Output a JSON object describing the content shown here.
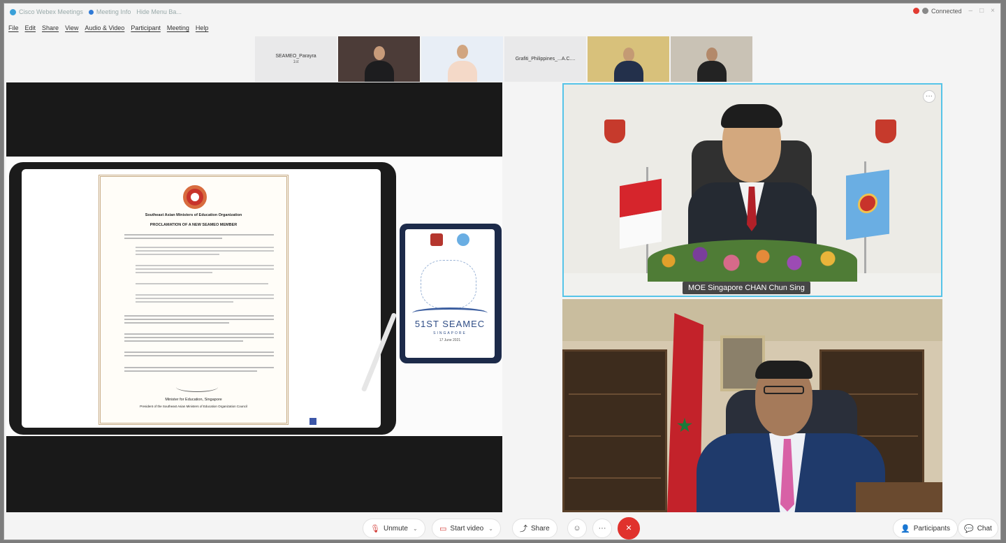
{
  "window": {
    "app_title": "Cisco Webex Meetings",
    "meeting_info_label": "Meeting Info",
    "view_label": "Hide Menu Ba...",
    "status": "Connected",
    "status_color": "#e23b32"
  },
  "menu": [
    "File",
    "Edit",
    "Share",
    "View",
    "Audio & Video",
    "Participant",
    "Meeting",
    "Help"
  ],
  "thumbnails": [
    {
      "type": "name",
      "name": "SEAMEO_Parayra",
      "sub": "1st"
    },
    {
      "type": "video",
      "bg": "#4c3c38"
    },
    {
      "type": "video",
      "bg": "#e8eef6"
    },
    {
      "type": "name",
      "name": "Grafiti_Philippines_...A.C....",
      "sub": ""
    },
    {
      "type": "video",
      "bg": "#d8c17b"
    },
    {
      "type": "video",
      "bg": "#c9c2b5"
    }
  ],
  "shared_content": {
    "cert_org": "Southeast Asian Ministers of Education Organization",
    "cert_title": "PROCLAMATION OF A NEW SEAMEO MEMBER",
    "cert_signatory": "Minister for Education, Singapore",
    "cert_footer": "President of the Southeast Asian Ministers of Education Organization Council",
    "event_brand": "51ST SEAMEC",
    "event_sub": "SINGAPORE",
    "event_date": "17 June 2021"
  },
  "video_tiles": {
    "main_speaker_label": "MOE Singapore CHAN Chun Sing",
    "more_icon": "ellipsis-icon",
    "accent_border": "#56c4e8"
  },
  "toolbar": {
    "unmute_label": "Unmute",
    "start_video_label": "Start video",
    "share_label": "Share",
    "more_label": "···",
    "end_label": "✕",
    "participants_label": "Participants",
    "chat_label": "Chat",
    "end_color": "#e0322d"
  }
}
